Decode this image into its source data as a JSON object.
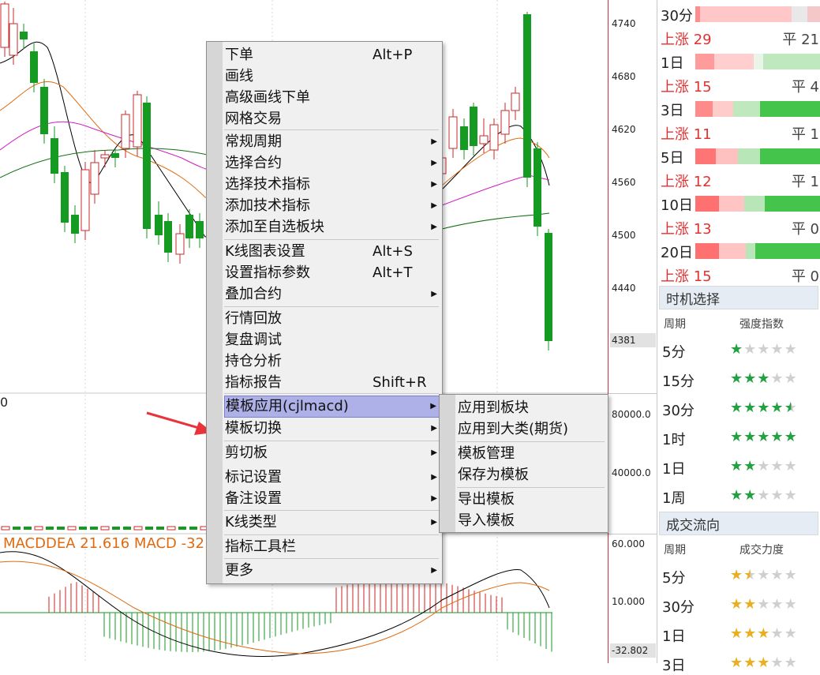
{
  "price_axis": {
    "labels": [
      "4740",
      "4680",
      "4620",
      "4560",
      "4500",
      "4440",
      "4381"
    ],
    "volume_labels": [
      "80000.0",
      "40000.0"
    ],
    "macd_labels": [
      "60.000",
      "10.000",
      "-32.802"
    ]
  },
  "macd_readout": "MACDDEA 21.616  MACD -32",
  "partial_zero": "0",
  "context_menu": {
    "items": [
      {
        "label": "下单",
        "shortcut": "Alt+P",
        "submenu": false
      },
      {
        "label": "画线",
        "shortcut": "",
        "submenu": false
      },
      {
        "label": "高级画线下单",
        "shortcut": "",
        "submenu": false
      },
      {
        "label": "网格交易",
        "shortcut": "",
        "submenu": false
      },
      {
        "label": "常规周期",
        "shortcut": "",
        "submenu": true
      },
      {
        "label": "选择合约",
        "shortcut": "",
        "submenu": true
      },
      {
        "label": "选择技术指标",
        "shortcut": "",
        "submenu": true
      },
      {
        "label": "添加技术指标",
        "shortcut": "",
        "submenu": true
      },
      {
        "label": "添加至自选板块",
        "shortcut": "",
        "submenu": true
      },
      {
        "label": "K线图表设置",
        "shortcut": "Alt+S",
        "submenu": false
      },
      {
        "label": "设置指标参数",
        "shortcut": "Alt+T",
        "submenu": false
      },
      {
        "label": "叠加合约",
        "shortcut": "",
        "submenu": true
      },
      {
        "label": "行情回放",
        "shortcut": "",
        "submenu": false
      },
      {
        "label": "复盘调试",
        "shortcut": "",
        "submenu": false
      },
      {
        "label": "持仓分析",
        "shortcut": "",
        "submenu": false
      },
      {
        "label": "指标报告",
        "shortcut": "Shift+R",
        "submenu": false
      },
      {
        "label": "模板应用(cjlmacd)",
        "shortcut": "",
        "submenu": true,
        "highlighted": true
      },
      {
        "label": "模板切换",
        "shortcut": "",
        "submenu": true
      },
      {
        "label": "剪切板",
        "shortcut": "",
        "submenu": true
      },
      {
        "label": "标记设置",
        "shortcut": "",
        "submenu": true
      },
      {
        "label": "备注设置",
        "shortcut": "",
        "submenu": true
      },
      {
        "label": "K线类型",
        "shortcut": "",
        "submenu": true
      },
      {
        "label": "指标工具栏",
        "shortcut": "",
        "submenu": false
      },
      {
        "label": "更多",
        "shortcut": "",
        "submenu": true
      }
    ]
  },
  "template_submenu": {
    "items": [
      "应用到板块",
      "应用到大类(期货)",
      "模板管理",
      "保存为模板",
      "导出模板",
      "导入模板"
    ]
  },
  "breadth_panel": {
    "rows": [
      {
        "period": "30分",
        "up": "上涨 29",
        "flat": "平 21"
      },
      {
        "period": "1日",
        "up": "上涨 15",
        "flat": "平 4"
      },
      {
        "period": "3日",
        "up": "上涨 11",
        "flat": "平 1"
      },
      {
        "period": "5日",
        "up": "上涨 12",
        "flat": "平 1"
      },
      {
        "period": "10日",
        "up": "上涨 13",
        "flat": "平 0"
      },
      {
        "period": "20日",
        "up": "上涨 15",
        "flat": "平 0"
      }
    ]
  },
  "timing_section": {
    "title": "时机选择",
    "col_period": "周期",
    "col_strength": "强度指数",
    "rows": [
      {
        "tf": "5分",
        "stars": 1.0
      },
      {
        "tf": "15分",
        "stars": 3.0
      },
      {
        "tf": "30分",
        "stars": 4.5
      },
      {
        "tf": "1时",
        "stars": 5.0
      },
      {
        "tf": "1日",
        "stars": 2.0
      },
      {
        "tf": "1周",
        "stars": 2.0
      }
    ]
  },
  "flow_section": {
    "title": "成交流向",
    "col_period": "周期",
    "col_strength": "成交力度",
    "rows": [
      {
        "tf": "5分",
        "stars": 1.5
      },
      {
        "tf": "30分",
        "stars": 2.0
      },
      {
        "tf": "1日",
        "stars": 3.0
      },
      {
        "tf": "3日",
        "stars": 3.0
      }
    ]
  },
  "colors": {
    "up_red": "#e23131",
    "down_green": "#20a030",
    "star_green": "#21a140",
    "star_gold": "#e8b020",
    "menu_highlight": "#aeb0e8",
    "annotation_arrow": "#e8333a"
  }
}
